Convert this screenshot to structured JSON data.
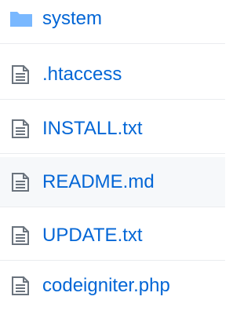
{
  "files": [
    {
      "name": "system",
      "type": "folder"
    },
    {
      "name": ".htaccess",
      "type": "file"
    },
    {
      "name": "INSTALL.txt",
      "type": "file"
    },
    {
      "name": "README.md",
      "type": "file"
    },
    {
      "name": "UPDATE.txt",
      "type": "file"
    },
    {
      "name": "codeigniter.php",
      "type": "file"
    }
  ],
  "colors": {
    "link": "#0366d6",
    "folder": "#79b8ff",
    "file_icon": "#6a737d",
    "row_highlight": "#f6f8fa"
  }
}
